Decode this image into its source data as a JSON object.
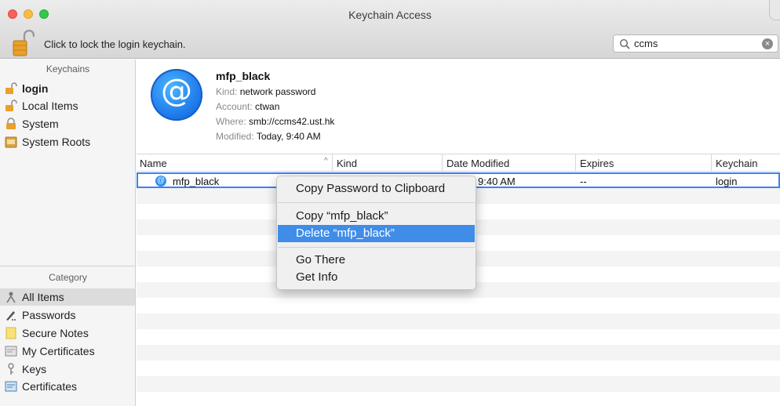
{
  "window": {
    "title": "Keychain Access"
  },
  "toolbar": {
    "lock_label": "Click to lock the login keychain.",
    "search": {
      "value": "ccms",
      "icon": "search-icon",
      "clear_icon": "clear-search-icon"
    }
  },
  "sidebar": {
    "keychains_header": "Keychains",
    "keychains": [
      {
        "label": "login",
        "icon": "unlocked-lock-icon",
        "bold": true
      },
      {
        "label": "Local Items",
        "icon": "unlocked-lock-icon"
      },
      {
        "label": "System",
        "icon": "locked-lock-icon"
      },
      {
        "label": "System Roots",
        "icon": "cabinet-icon"
      }
    ],
    "category_header": "Category",
    "categories": [
      {
        "label": "All Items",
        "icon": "all-items-icon",
        "selected": true
      },
      {
        "label": "Passwords",
        "icon": "pen-icon"
      },
      {
        "label": "Secure Notes",
        "icon": "note-icon"
      },
      {
        "label": "My Certificates",
        "icon": "certificate-icon"
      },
      {
        "label": "Keys",
        "icon": "key-icon"
      },
      {
        "label": "Certificates",
        "icon": "certificate-icon"
      }
    ]
  },
  "detail": {
    "icon": "at-sign-icon",
    "icon_glyph": "@",
    "name": "mfp_black",
    "kind_key": "Kind:",
    "kind_val": "network password",
    "account_key": "Account:",
    "account_val": "ctwan",
    "where_key": "Where:",
    "where_val": "smb://ccms42.ust.hk",
    "modified_key": "Modified:",
    "modified_val": "Today, 9:40 AM"
  },
  "table": {
    "columns": [
      "Name",
      "Kind",
      "Date Modified",
      "Expires",
      "Keychain"
    ],
    "sort_indicator": "^",
    "rows": [
      {
        "icon_glyph": "@",
        "name": "mfp_black",
        "date": "9:40 AM",
        "expires": "--",
        "keychain": "login"
      }
    ]
  },
  "context_menu": {
    "items": [
      {
        "label": "Copy Password to Clipboard"
      },
      {
        "label": "Copy “mfp_black”"
      },
      {
        "label": "Delete “mfp_black”",
        "highlighted": true
      },
      {
        "label": "Go There"
      },
      {
        "label": "Get Info"
      }
    ]
  },
  "colors": {
    "selection": "#3f8de8",
    "focus_ring": "#3b82f6"
  }
}
